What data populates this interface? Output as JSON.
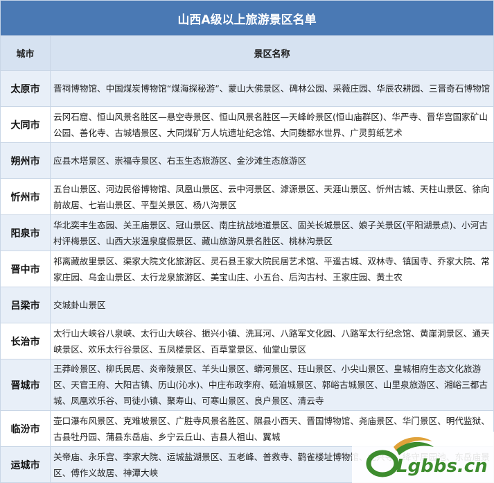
{
  "title": "山西A级以上旅游景区名单",
  "headers": {
    "city": "城市",
    "spots": "景区名称"
  },
  "rows": [
    {
      "city": "太原市",
      "spots": "晋祠博物馆、中国煤炭博物馆“煤海探秘游”、蒙山大佛景区、碑林公园、采薇庄园、华辰农耕园、三晋奇石博物馆"
    },
    {
      "city": "大同市",
      "spots": "云冈石窟、恒山风景名胜区—悬空寺景区、恒山风景名胜区—天峰岭景区(恒山庙群区)、华严寺、晋华宫国家矿山公园、善化寺、古城墙景区、大同煤矿万人坑遗址纪念馆、大同魏都水世界、广灵剪纸艺术"
    },
    {
      "city": "朔州市",
      "spots": "应县木塔景区、崇福寺景区、右玉生态旅游区、金沙滩生态旅游区"
    },
    {
      "city": "忻州市",
      "spots": "五台山景区、河边民俗博物馆、凤凰山景区、云中河景区、滹源景区、天涯山景区、忻州古城、天柱山景区、徐向前故居、七岩山景区、平型关景区、杨八沟景区"
    },
    {
      "city": "阳泉市",
      "spots": "华北奕丰生态园、关王庙景区、冠山景区、南庄抗战地道景区、固关长城景区、娘子关景区(平阳湖景点)、小河古村评梅景区、山西大汖温泉度假景区、藏山旅游风景名胜区、桃林沟景区"
    },
    {
      "city": "晋中市",
      "spots": "祁离藏故里景区、渠家大院文化旅游区、灵石县王家大院民居艺术馆、平遥古城、双林寺、镇国寺、乔家大院、常家庄园、乌金山景区、太行龙泉旅游区、美宝山庄、小五台、后沟古村、王家庄园、黄土农"
    },
    {
      "city": "吕梁市",
      "spots": "交城卦山景区"
    },
    {
      "city": "长治市",
      "spots": "太行山大峡谷八泉峡、太行山大峡谷、振兴小镇、洗耳河、八路军文化园、八路军太行纪念馆、黄崖洞景区、通天峡景区、欢乐太行谷景区、五凤楼景区、百草堂景区、仙堂山景区"
    },
    {
      "city": "晋城市",
      "spots": "王莽岭景区、柳氏民居、炎帝陵景区、羊头山景区、蟒河景区、珏山景区、小尖山景区、皇城相府生态文化旅游区、天官王府、大阳古镇、历山(沁水)、中庄布政李府、砥洎城景区、郭峪古城景区、山里泉旅游区、湘峪三都古城、凤凰欢乐谷、司徒小镇、聚寿山、可寒山景区、良户景区、清云寺"
    },
    {
      "city": "临汾市",
      "spots": "壶口瀑布风景区、克难坡景区、广胜寺风景名胜区、隰县小西天、晋国博物馆、尧庙景区、华门景区、明代监狱、古县牡丹园、蒲县东岳庙、乡宁云丘山、吉县人祖山、翼城"
    },
    {
      "city": "运城市",
      "spots": "关帝庙、永乐宫、李家大院、运城盐湖景区、五老峰、普救寺、鹳雀楼址博物馆、龙兴寺、绛守居园池、东岳庙景区、傅作义故居、神潭大峡"
    }
  ],
  "watermark": {
    "text": "Lgbbs.cn"
  },
  "colors": {
    "title_bg": "#4a79b4",
    "header_bg": "#d6e2f1",
    "band": "#e8eff8",
    "border": "#c9d6e6",
    "logo_green": "#3d8c2e"
  }
}
